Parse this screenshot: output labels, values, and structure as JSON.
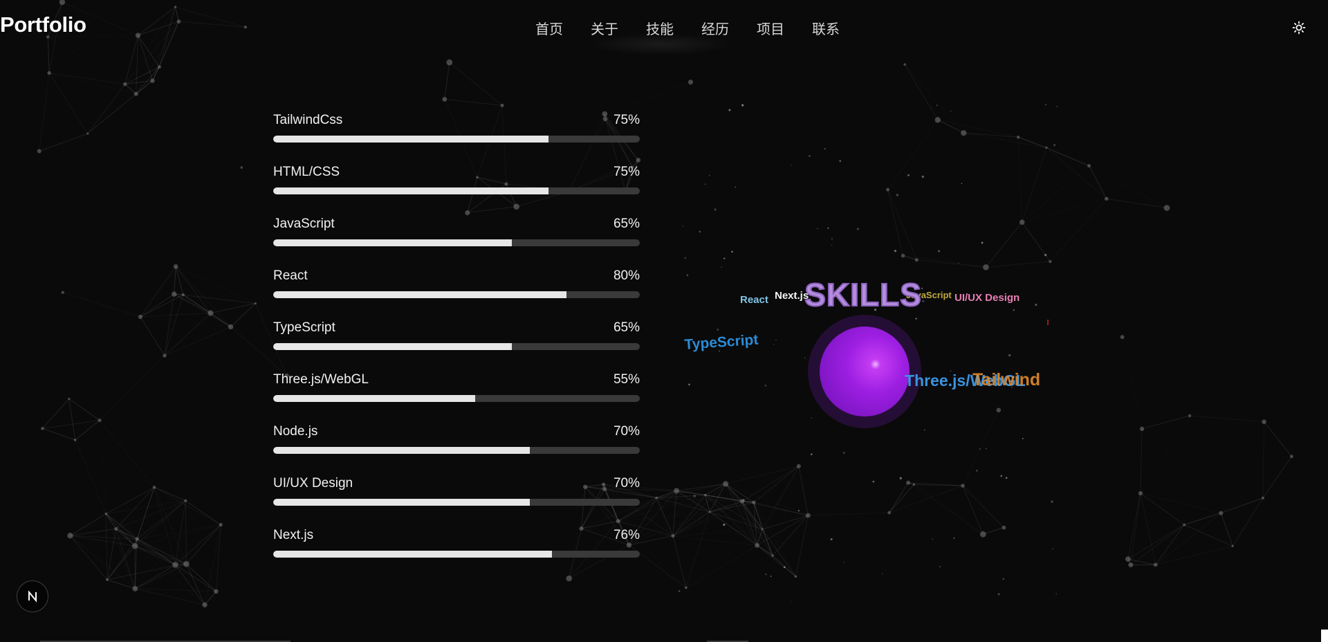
{
  "header": {
    "logo": "Portfolio",
    "nav": [
      {
        "label": "首页"
      },
      {
        "label": "关于"
      },
      {
        "label": "技能"
      },
      {
        "label": "经历"
      },
      {
        "label": "项目"
      },
      {
        "label": "联系"
      }
    ],
    "theme_icon": "sun-icon"
  },
  "skills": [
    {
      "name": "TailwindCss",
      "percent": "75%",
      "level": 0.75
    },
    {
      "name": "HTML/CSS",
      "percent": "75%",
      "level": 0.75
    },
    {
      "name": "JavaScript",
      "percent": "65%",
      "level": 0.65
    },
    {
      "name": "React",
      "percent": "80%",
      "level": 0.8
    },
    {
      "name": "TypeScript",
      "percent": "65%",
      "level": 0.65
    },
    {
      "name": "Three.js/WebGL",
      "percent": "55%",
      "level": 0.55
    },
    {
      "name": "Node.js",
      "percent": "70%",
      "level": 0.7
    },
    {
      "name": "UI/UX Design",
      "percent": "70%",
      "level": 0.7
    },
    {
      "name": "Next.js",
      "percent": "76%",
      "level": 0.76
    }
  ],
  "skills_scene": {
    "title": "SKILLS",
    "labels": [
      "React",
      "Next.js",
      "TypeScript",
      "Three.js/WebGL",
      "Tailwind",
      "JavaScript",
      "UI/UX Design"
    ]
  },
  "badge": {
    "letter": "N",
    "icon": "nextjs-logo-icon"
  },
  "colors": {
    "background": "#0a0a0a",
    "bar_fill": "#e6e6e6",
    "bar_track": "#3a3a3a",
    "sphere": "#9b1fe0",
    "skills_title": "#b08ad8"
  }
}
